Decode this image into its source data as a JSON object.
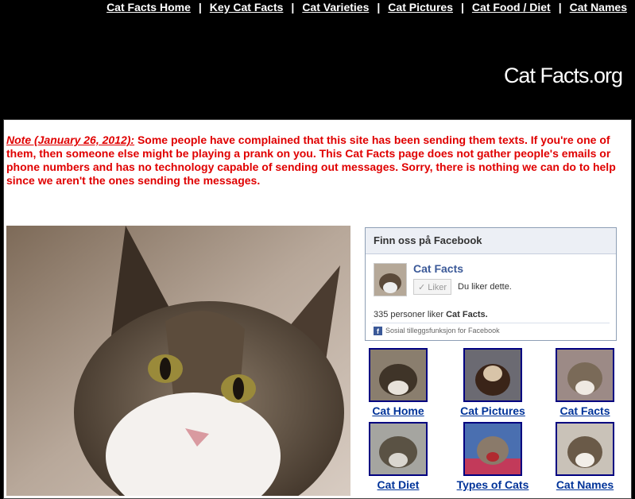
{
  "nav": {
    "items": [
      {
        "label": "Cat Facts Home"
      },
      {
        "label": "Key Cat Facts"
      },
      {
        "label": "Cat Varieties"
      },
      {
        "label": "Cat Pictures"
      },
      {
        "label": "Cat Food / Diet"
      },
      {
        "label": "Cat Names"
      }
    ],
    "separator": "|"
  },
  "site": {
    "logo": "Cat Facts.org"
  },
  "note": {
    "date": "Note (January 26, 2012):",
    "text": " Some people have complained that this site has been sending them texts.  If you're one of them, then someone else might be playing a prank on you.  This Cat Facts page does not gather people's emails or phone numbers and has no technology capable of sending out messages.  Sorry, there is nothing we can do to help since we aren't the ones sending the messages."
  },
  "facebook": {
    "header": "Finn oss på Facebook",
    "page_name": "Cat Facts",
    "like_button": "Liker",
    "you_like": "Du liker dette.",
    "count_prefix": "335 personer liker ",
    "count_page": "Cat Facts.",
    "plugin_label": "Sosial tilleggsfunksjon for Facebook"
  },
  "tiles": [
    {
      "label": "Cat Home"
    },
    {
      "label": "Cat Pictures"
    },
    {
      "label": "Cat Facts"
    },
    {
      "label": "Cat Diet"
    },
    {
      "label": "Types of Cats"
    },
    {
      "label": "Cat Names"
    }
  ],
  "colors": {
    "note": "#e00000",
    "link": "#003399",
    "fb_blue": "#3b5998"
  }
}
